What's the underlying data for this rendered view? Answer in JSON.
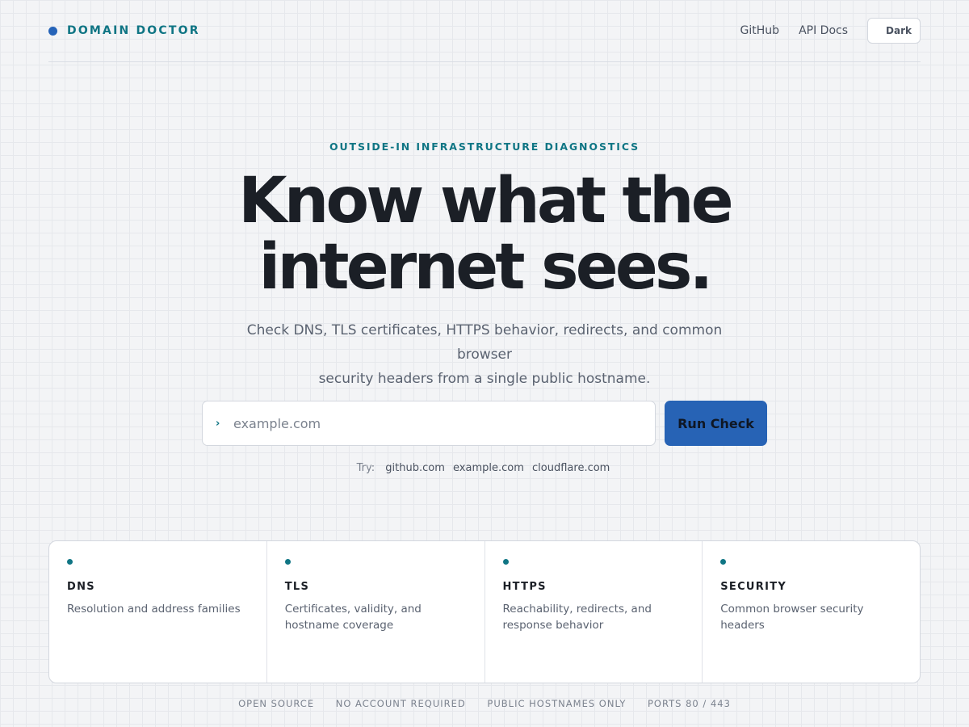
{
  "header": {
    "brand": "DOMAIN DOCTOR",
    "nav": {
      "github": "GitHub",
      "api_docs": "API Docs",
      "theme_toggle": "Dark"
    }
  },
  "hero": {
    "eyebrow": "OUTSIDE-IN INFRASTRUCTURE DIAGNOSTICS",
    "headline_line1": "Know what the",
    "headline_line2": "internet sees.",
    "subtitle_line1": "Check DNS, TLS certificates, HTTPS behavior, redirects, and common browser",
    "subtitle_line2": "security headers from a single public hostname."
  },
  "search": {
    "prompt_icon": "›",
    "placeholder": "example.com",
    "value": "",
    "button": "Run Check"
  },
  "examples": {
    "label": "Try:",
    "items": [
      "github.com",
      "example.com",
      "cloudflare.com"
    ]
  },
  "cards": [
    {
      "title": "DNS",
      "desc": "Resolution and address families"
    },
    {
      "title": "TLS",
      "desc": "Certificates, validity, and hostname coverage"
    },
    {
      "title": "HTTPS",
      "desc": "Reachability, redirects, and response behavior"
    },
    {
      "title": "SECURITY",
      "desc": "Common browser security headers"
    }
  ],
  "footer": [
    "OPEN SOURCE",
    "NO ACCOUNT REQUIRED",
    "PUBLIC HOSTNAMES ONLY",
    "PORTS 80 / 443"
  ],
  "colors": {
    "brand_blue": "#2563b8",
    "accent_teal": "#0f7584",
    "button_blue": "#2763b5",
    "background": "#f3f4f6"
  }
}
